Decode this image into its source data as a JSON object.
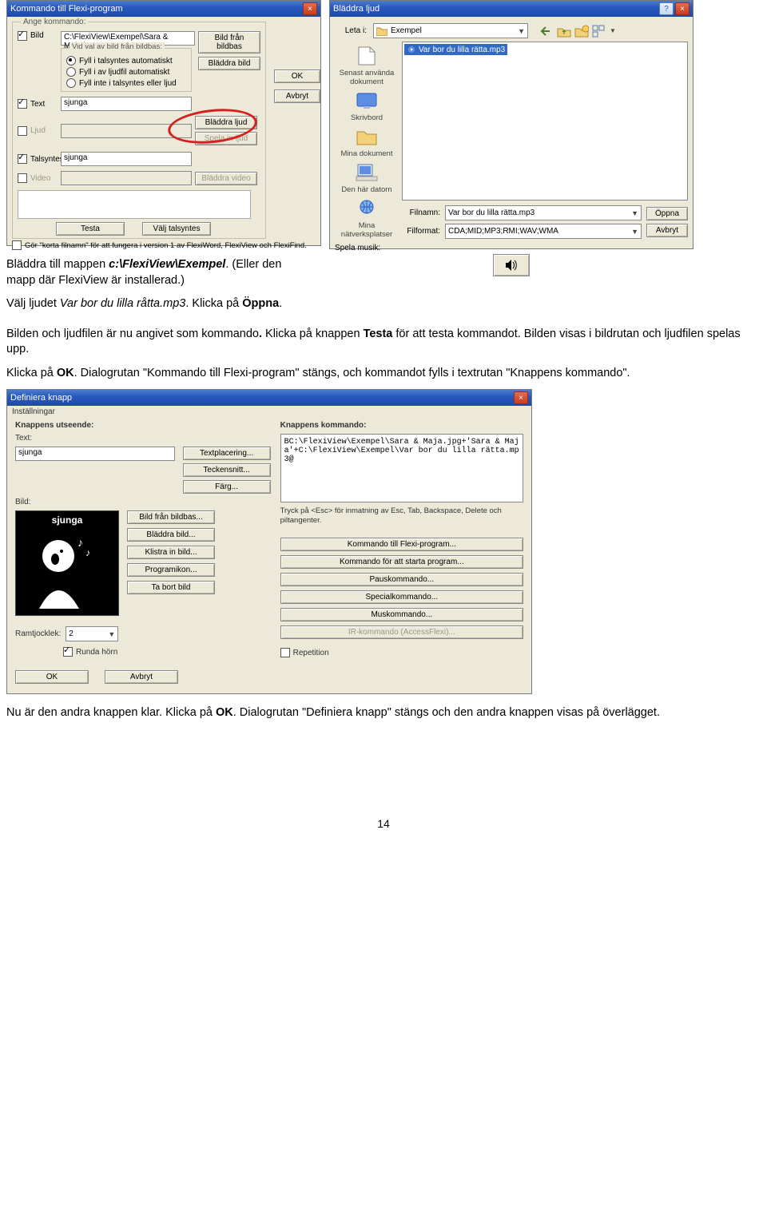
{
  "dlg1": {
    "title": "Kommando till Flexi-program",
    "group": "Ange kommando:",
    "bild_label": "Bild",
    "bild_path": "C:\\FlexiView\\Exempel\\Sara & Maja.jpg",
    "bild_bas_btn": "Bild från bildbas",
    "radiogroup_label": "Vid val av bild från bildbas:",
    "r1": "Fyll i talsyntes automatiskt",
    "r2": "Fyll i av ljudfil automatiskt",
    "r3": "Fyll inte i talsyntes eller ljud",
    "bladdra_bild": "Bläddra bild",
    "text_label": "Text",
    "text_val": "sjunga",
    "ljud_label": "Ljud",
    "bladdra_ljud": "Bläddra ljud",
    "spela_in": "Spela in ljud",
    "talsyntes_label": "Talsyntes",
    "talsyntes_val": "sjunga",
    "video_label": "Video",
    "bladdra_video": "Bläddra video",
    "testa": "Testa",
    "valj_tal": "Välj talsyntes",
    "korta_check": "Gör \"korta filnamn\" för att fungera i version 1 av FlexiWord, FlexiView och FlexiFind.",
    "ok": "OK",
    "avbryt": "Avbryt"
  },
  "dlg2": {
    "title": "Bläddra ljud",
    "leta": "Leta i:",
    "folder": "Exempel",
    "sp": {
      "recent": "Senast använda dokument",
      "desktop": "Skrivbord",
      "mydocs": "Mina dokument",
      "mycomp": "Den här datorn",
      "netw": "Mina nätverksplatser"
    },
    "file_sel": "Var bor du lilla rätta.mp3",
    "filnamn_l": "Filnamn:",
    "filnamn_v": "Var bor du lilla rätta.mp3",
    "filformat_l": "Filformat:",
    "filformat_v": "CDA;MID;MP3;RMI;WAV;WMA",
    "oppna": "Öppna",
    "avbryt": "Avbryt",
    "spela": "Spela musik:"
  },
  "body": {
    "p1a": "Bläddra till mappen ",
    "p1b": "c:\\FlexiView\\Exempel",
    "p1c": ". (Eller den mapp där FlexiView är installerad.)",
    "p2a": "Välj ljudet ",
    "p2b": "Var bor du lilla råtta.mp3",
    "p2c": ". Klicka på ",
    "p2d": "Öppna",
    "p2e": ".",
    "p3a": "Bilden och ljudfilen är nu angivet som kommando",
    "p3b": ". ",
    "p3c": "Klicka på knappen ",
    "p3d": "Testa",
    "p3e": " för att testa kommandot. Bilden visas i bildrutan och ljudfilen spelas upp.",
    "p4a": "Klicka på ",
    "p4b": "OK",
    "p4c": ". Dialogrutan \"Kommando till Flexi-program\" stängs, och kommandot fylls i textrutan \"Knappens kommando\".",
    "p5a": "Nu är den andra knappen klar. Klicka på ",
    "p5b": "OK",
    "p5c": ". Dialogrutan \"Definiera knapp\" stängs och den andra knappen visas på överlägget."
  },
  "dlg3": {
    "title": "Definiera knapp",
    "menu": "Inställningar",
    "col1_h": "Knappens utseende:",
    "text_l": "Text:",
    "text_v": "sjunga",
    "b_pl": "Textplacering...",
    "b_tk": "Teckensnitt...",
    "b_fg": "Färg...",
    "bild_l": "Bild:",
    "prev_label": "sjunga",
    "b_bb": "Bild från bildbas...",
    "b_bl": "Bläddra bild...",
    "b_ki": "Klistra in bild...",
    "b_pi": "Programikon...",
    "b_tb": "Ta bort bild",
    "ramt": "Ramtjocklek:",
    "ramv": "2",
    "rund": "Runda hörn",
    "ok": "OK",
    "avbryt": "Avbryt",
    "col2_h": "Knappens kommando:",
    "cmd": "BC:\\FlexiView\\Exempel\\Sara & Maja.jpg+'Sara & Maja'+C:\\FlexiView\\Exempel\\Var bor du lilla rätta.mp3@",
    "hint": "Tryck på <Esc> för inmatning av Esc, Tab, Backspace, Delete och piltangenter.",
    "b_ktf": "Kommando till Flexi-program...",
    "b_ksp": "Kommando för att starta program...",
    "b_pk": "Pauskommando...",
    "b_sk": "Specialkommando...",
    "b_mk": "Muskommando...",
    "b_ir": "IR-kommando (AccessFlexi)...",
    "rep": "Repetition"
  },
  "pagenum": "14"
}
